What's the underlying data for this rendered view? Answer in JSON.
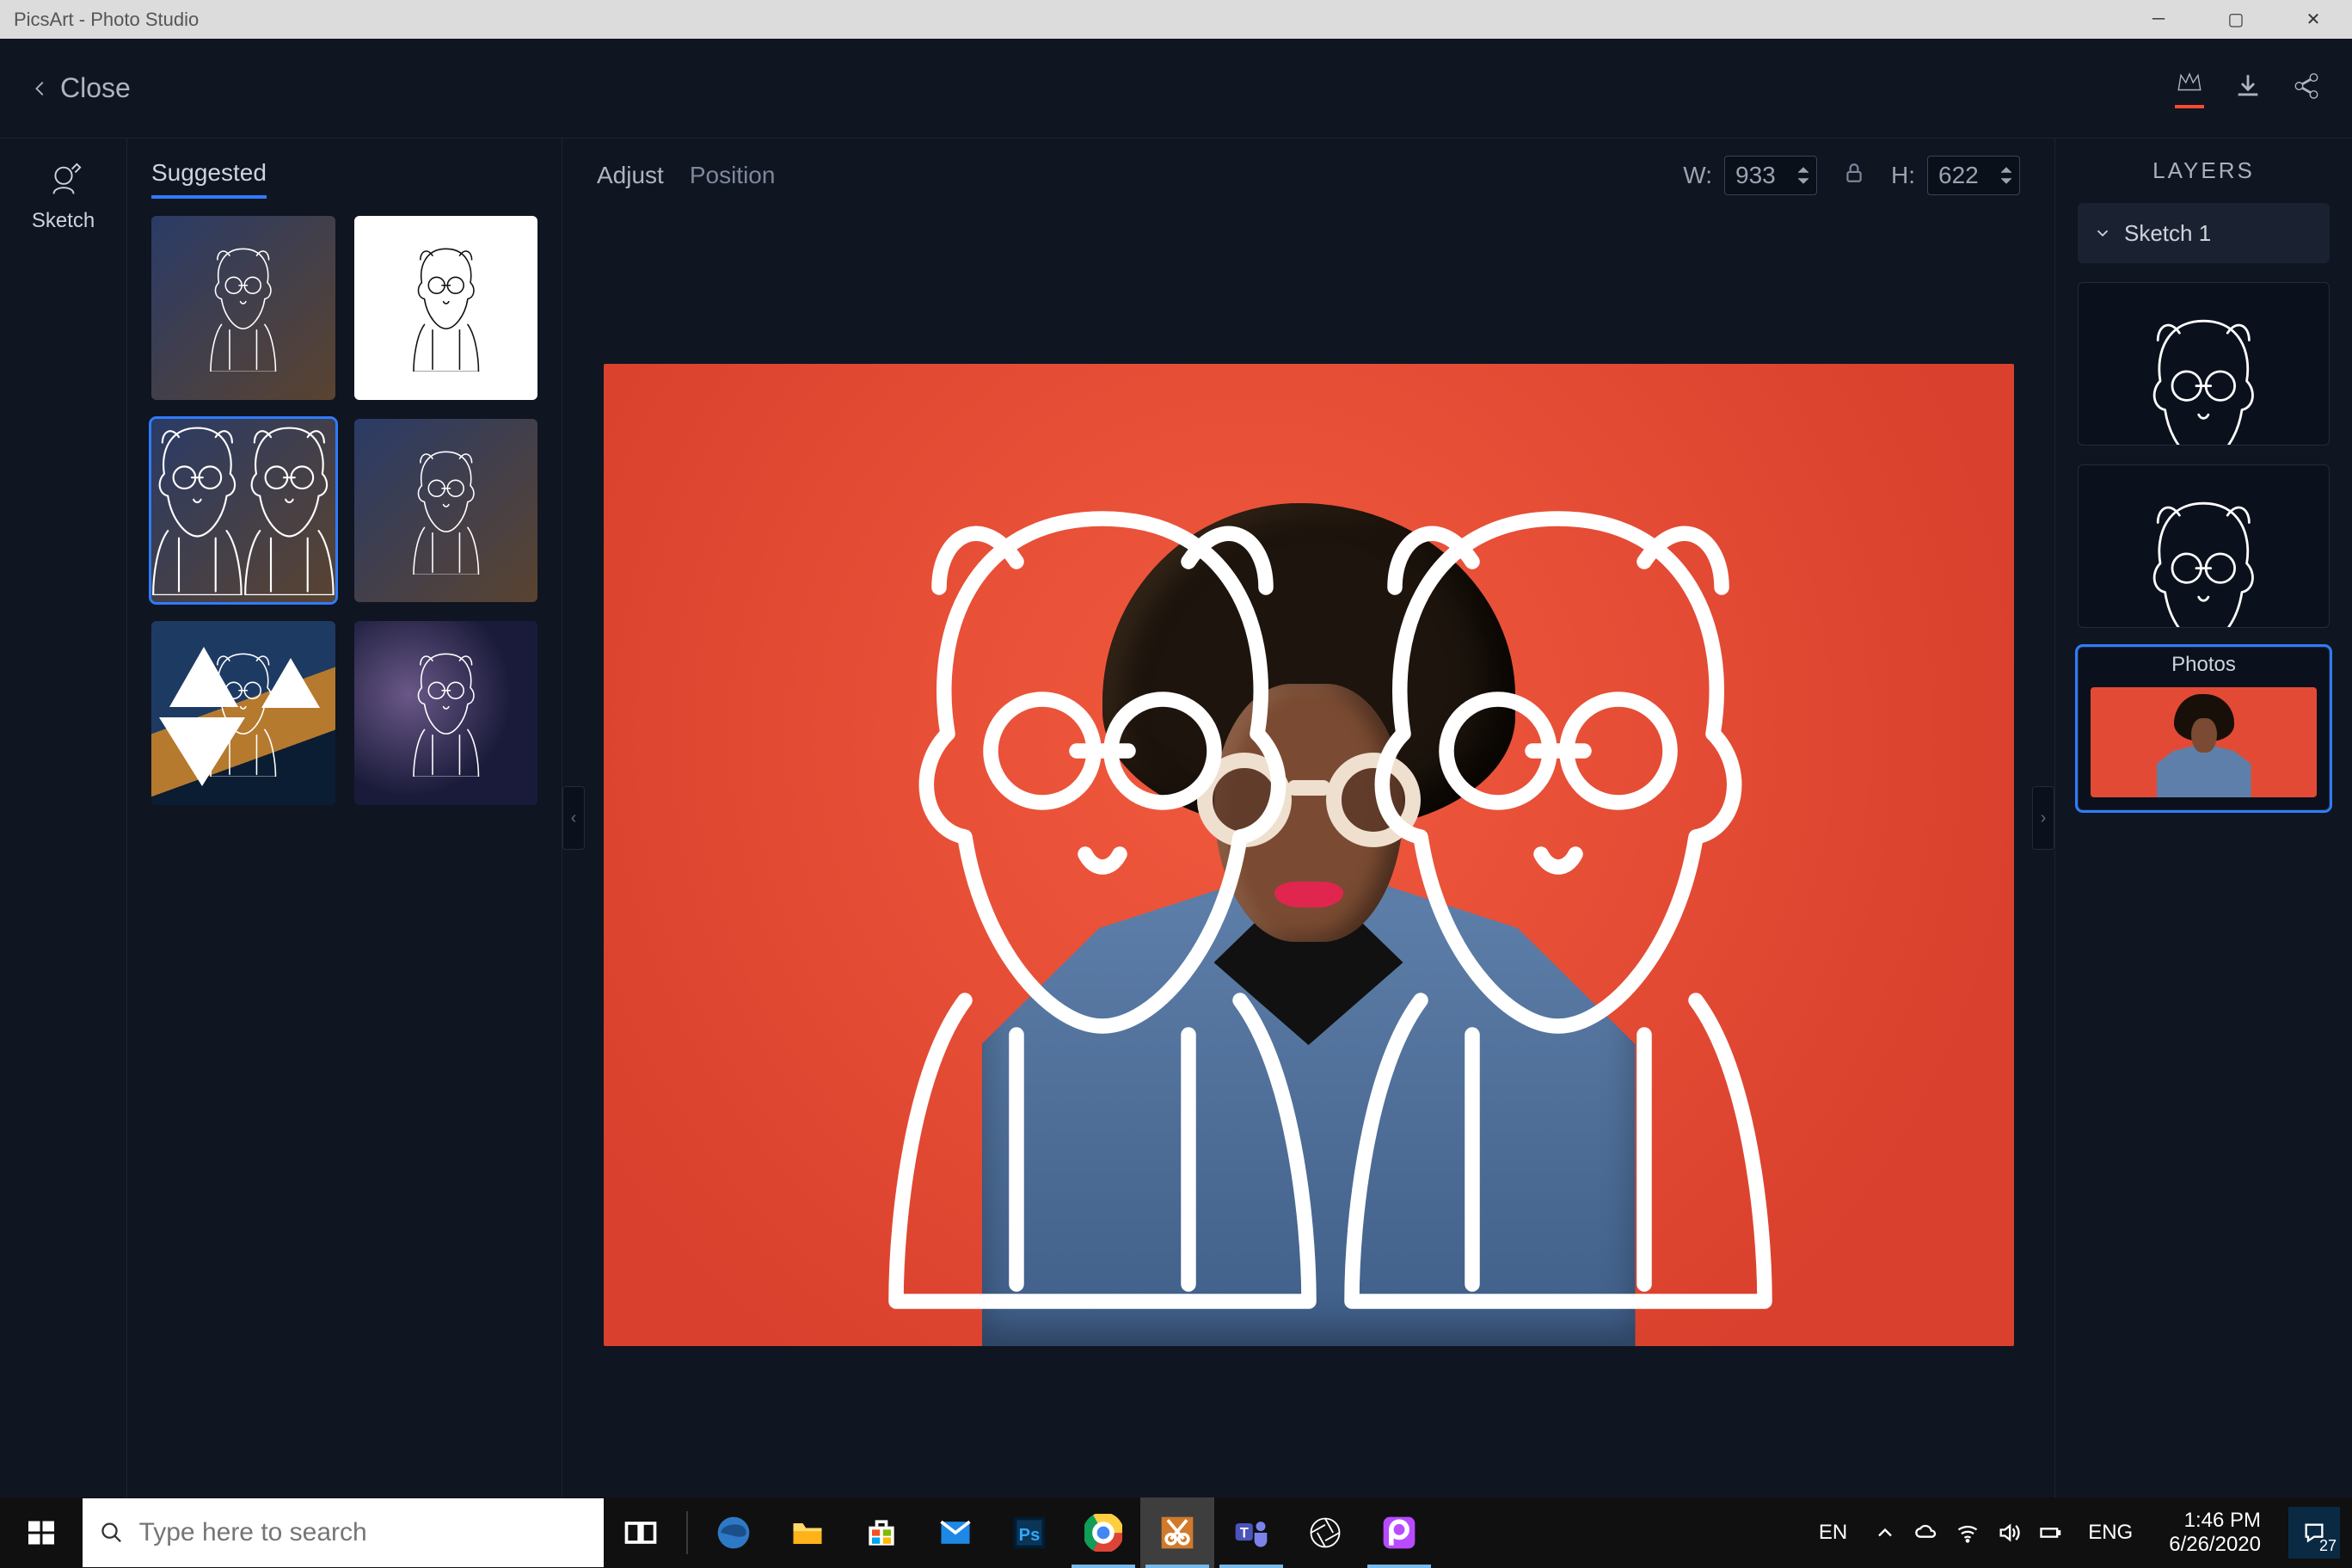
{
  "window": {
    "title": "PicsArt - Photo Studio"
  },
  "appbar": {
    "close": "Close"
  },
  "rail": {
    "sketch": "Sketch"
  },
  "suggested": {
    "title": "Suggested",
    "items": [
      "preset-1",
      "preset-2",
      "preset-3",
      "preset-4",
      "preset-5",
      "preset-6"
    ]
  },
  "controls": {
    "adjust": "Adjust",
    "position": "Position",
    "w_label": "W:",
    "h_label": "H:",
    "width": "933",
    "height": "622"
  },
  "layers": {
    "title": "LAYERS",
    "sketch1": "Sketch 1",
    "photos": "Photos"
  },
  "taskbar": {
    "search_placeholder": "Type here to search",
    "lang1": "EN",
    "lang2": "ENG",
    "time": "1:46 PM",
    "date": "6/26/2020",
    "badge": "27"
  }
}
